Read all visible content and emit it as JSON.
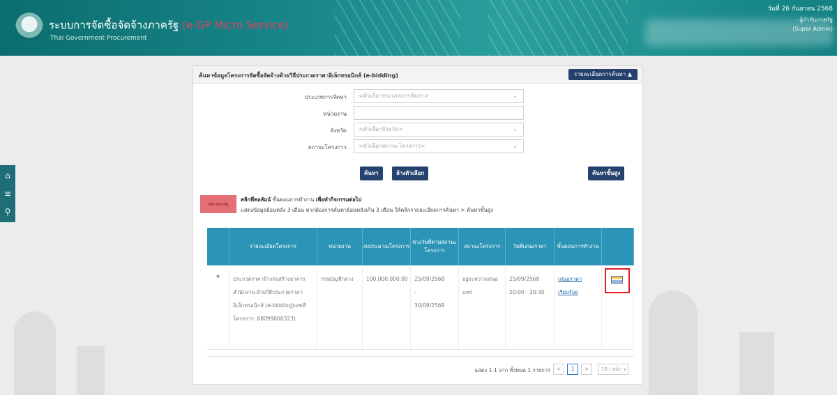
{
  "header": {
    "title": "ระบบการจัดซื้อจัดจ้างภาครัฐ",
    "title_suffix": "(e-GP Micro Service)",
    "subtitle": "Thai Government Procurement",
    "date": "วันที่ 26 กันยายน 2568",
    "user_role": "- ผู้กำกับภาครัฐ",
    "user_type": "(Super Admin)"
  },
  "rail": {
    "icons": [
      "home-icon",
      "menu-icon",
      "search-icon"
    ]
  },
  "panel": {
    "title": "ค้นหาข้อมูลโครงการจัดซื้อจัดจ้างด้วยวิธีประกวดราคาอิเล็กทรอนิกส์ (e-bidding)",
    "detail_button": "รายละเอียดการค้นหา ▲"
  },
  "form": {
    "procure_type": {
      "label": "ประเภทการจัดหา",
      "placeholder": "<ตัวเลือกประเภทการจัดหา>"
    },
    "agency": {
      "label": "หน่วยงาน",
      "value": ""
    },
    "province": {
      "label": "จังหวัด",
      "placeholder": "<ตัวเลือกจังหวัด>"
    },
    "project_status": {
      "label": "สถานะโครงการ",
      "placeholder": "<ตัวเลือกสถานะโครงการ>"
    },
    "search_button": "ค้นหา",
    "clear_button": "ล้างตัวเลือก",
    "advanced_button": "ค้นหาขั้นสูง"
  },
  "note": {
    "tag": "หมายเหตุ",
    "line1_bold": "คลิกที่คอลัมน์",
    "line1": " ขั้นตอนการทำงาน ",
    "line1_bold2": "เพื่อทำกิจกรรมต่อไป",
    "line2": "แสดงข้อมูลย้อนหลัง 3 เดือน หากต้องการค้นหาย้อนหลังเกิน 3 เดือน ให้คลิกรายละเอียดการค้นหา > ค้นหาขั้นสูง"
  },
  "table": {
    "headers": [
      "",
      "รายละเอียดโครงการ",
      "หน่วยงาน",
      "งบประมาณโครงการ",
      "ช่วงวันที่ตามสถานะโครงการ",
      "สถานะโครงการ",
      "วันที่เสนอราคา",
      "ขั้นตอนการทำงาน",
      ""
    ],
    "rows": [
      {
        "project": "ประกวดราคาจ้างก่อสร้างอาคารสำนักงาน ด้วยวิธีประกวดราคาอิเล็กทรอนิกส์ (e-bidding)เลขที่โครงการ: 68099000323)",
        "agency": "กรมบัญชีกลาง",
        "budget": "100,000,000.00",
        "period_start": "25/09/2568",
        "period_sep": "-",
        "period_end": "30/09/2568",
        "status": "อยู่ระหว่างเสนอแพร่",
        "bid_date": "25/09/2568",
        "bid_time": "20:00 - 20:30",
        "workflow_link1": "เสนอราคา",
        "workflow_link2": "เรียบร้อย"
      }
    ]
  },
  "pagination": {
    "info": "แสดง 1-1 จาก ทั้งหมด 1 รายการ",
    "prev": "<",
    "current": "1",
    "next": ">",
    "page_size": "10 / หน้า ∨"
  }
}
